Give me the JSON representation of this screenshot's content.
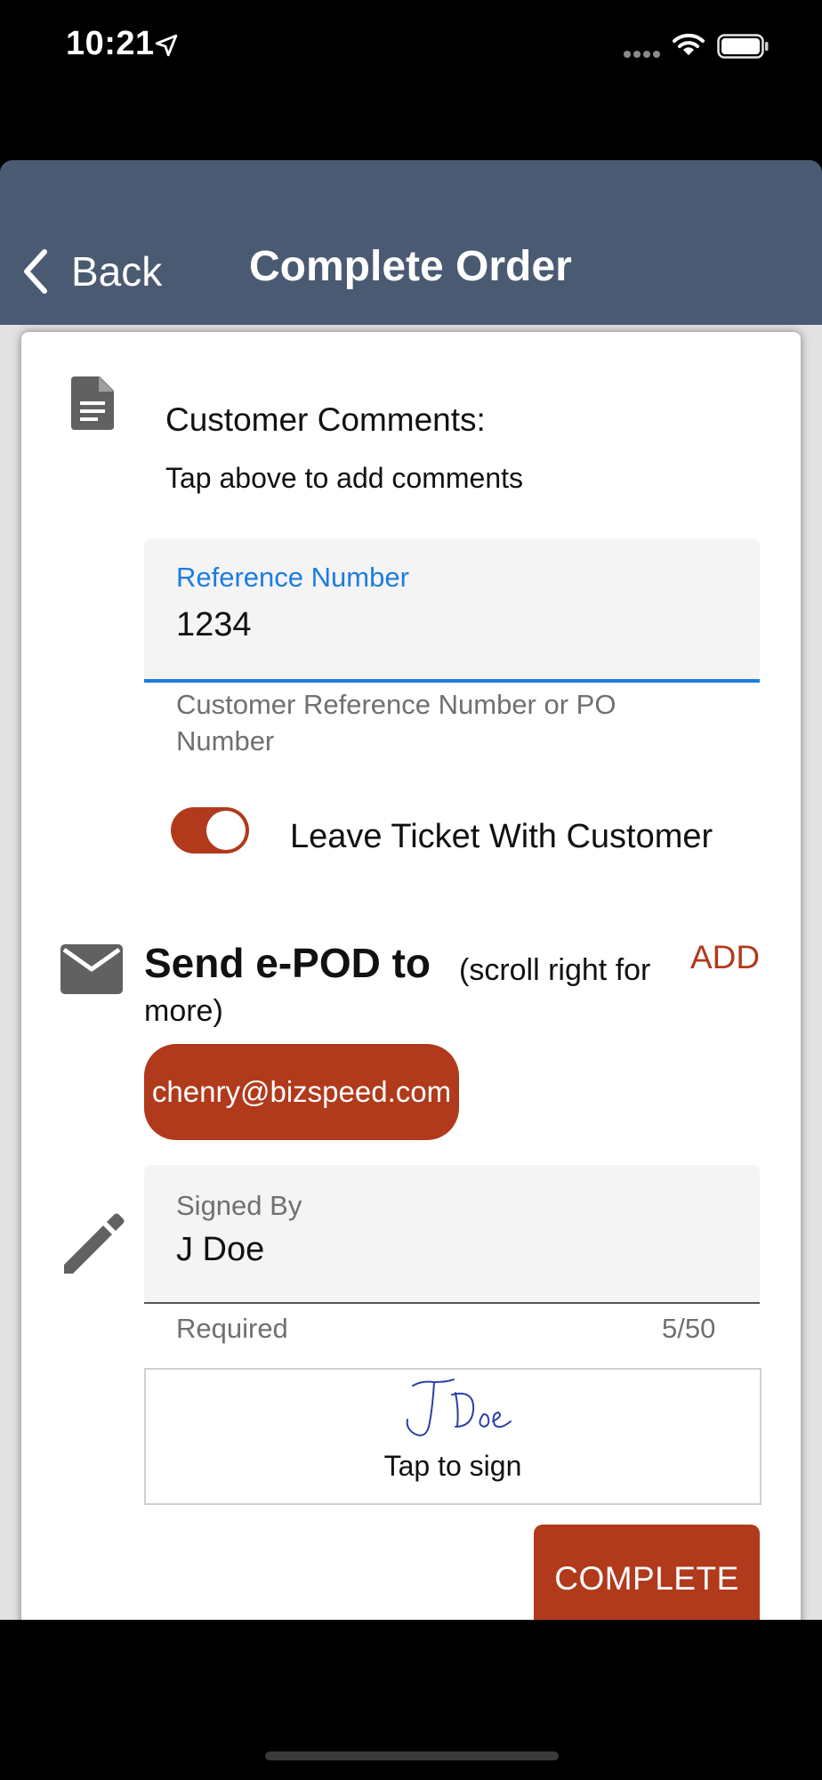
{
  "status_bar": {
    "time": "10:21",
    "icons": [
      "location-arrow-icon",
      "cellular-signal-icon",
      "wifi-icon",
      "battery-icon"
    ]
  },
  "nav": {
    "back_label": "Back",
    "title": "Complete Order",
    "background": "#4a5a72"
  },
  "comments": {
    "title": "Customer Comments:",
    "hint": "Tap above to add comments",
    "icon": "document-icon"
  },
  "reference": {
    "label": "Reference Number",
    "value": "1234",
    "helper": "Customer Reference Number or PO Number",
    "accent": "#1e7ce0"
  },
  "leave_ticket": {
    "label": "Leave Ticket With Customer",
    "enabled": true
  },
  "epod": {
    "title": "Send e-POD to",
    "note_line1": "(scroll right for",
    "note_line2": "more)",
    "add_label": "ADD",
    "emails": [
      "chenry@bizspeed.com"
    ],
    "icon": "mail-icon"
  },
  "signed_by": {
    "label": "Signed By",
    "value": "J Doe",
    "helper": "Required",
    "counter": "5/50",
    "icon": "pencil-icon"
  },
  "signature": {
    "hint": "Tap to sign",
    "signature_text": "J Doe"
  },
  "actions": {
    "complete_label": "COMPLETE",
    "accent": "#b13a1c"
  }
}
